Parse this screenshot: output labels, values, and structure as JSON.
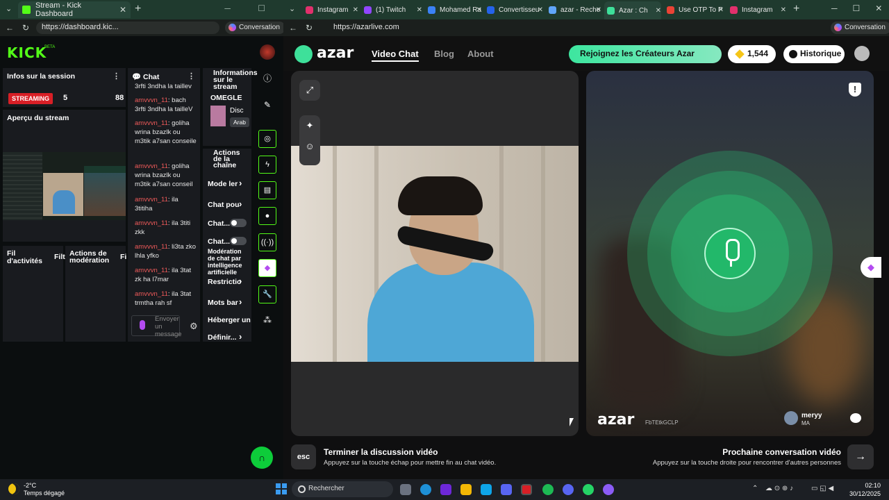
{
  "left_browser": {
    "tab_title": "Stream - Kick Dashboard",
    "url": "https://dashboard.kic...",
    "conversation_btn": "Conversation"
  },
  "kick": {
    "logo": "KICK",
    "beta": "BETA",
    "session_panel": {
      "title": "Infos sur la session",
      "streaming_badge": "STREAMING",
      "value1": "5",
      "value2": "88"
    },
    "preview_title": "Aperçu du stream",
    "activity_title": "Fil d'activités",
    "activity_filter": "Filt",
    "mod_actions_title": "Actions de modération",
    "mod_filter": "Fi",
    "chat": {
      "title": "Chat",
      "top_cut": "3rfti 3ndha la taillev",
      "messages": [
        {
          "user": "amvvvn_11",
          "text": ": bach 3rfti 3ndha la tailleV"
        },
        {
          "user": "amvvvn_11",
          "text": ": goliha wrina bzazlk ou m3tik a7san conseile"
        },
        {
          "user": "amvvvn_11",
          "text": ": goliha wrina bzazlk ou m3tik a7san conseil"
        },
        {
          "user": "amvvvn_11",
          "text": ": ila 3titiha"
        },
        {
          "user": "amvvvn_11",
          "text": ": ila 3titi zkk"
        },
        {
          "user": "amvvvn_11",
          "text": ": li3ta zko lhla yfko"
        },
        {
          "user": "amvvvn_11",
          "text": ": ila 3tat zk ha l7mar"
        },
        {
          "user": "amvvvn_11",
          "text": ": ila 3tat trmtha rah sf"
        }
      ],
      "input_placeholder": "Envoyer un message"
    },
    "info_panel": {
      "title": "Informations sur le stream",
      "category": "OMEGLE",
      "disc": "Disc",
      "tag": "Arab"
    },
    "channel_actions": {
      "title": "Actions de la chaîne",
      "items": [
        "Mode ler",
        "Chat pou",
        "Chat...",
        "Chat...",
        "Modération de chat par intelligence artificielle",
        "Restrictio",
        "Mots bar",
        "Héberger une",
        "Définir..."
      ]
    }
  },
  "right_browser": {
    "tabs": [
      "Instagram",
      "(1) Twitch",
      "Mohamed Ra",
      "Convertisseu",
      "azar - Reche",
      "Azar : Ch",
      "Use OTP To P",
      "Instagram"
    ],
    "url": "https://azarlive.com",
    "conversation_btn": "Conversation"
  },
  "azar": {
    "logo": "azar",
    "nav": [
      "Video Chat",
      "Blog",
      "About"
    ],
    "creators_btn": "Rejoignez les Créateurs Azar",
    "gems": "1,544",
    "history_btn": "Historique",
    "watermark": "azar",
    "watermark_code": "FbTEtkGCLP",
    "peer_name": "meryy",
    "peer_country": "MA",
    "end": {
      "key": "esc",
      "title": "Terminer la discussion vidéo",
      "sub": "Appuyez sur la touche échap pour mettre fin au chat vidéo."
    },
    "next": {
      "title": "Prochaine conversation vidéo",
      "sub": "Appuyez sur la touche droite pour rencontrer d'autres personnes"
    }
  },
  "taskbar": {
    "temp": "-2°C",
    "weather": "Temps dégagé",
    "search": "Rechercher",
    "time": "02:10",
    "date": "30/12/2025"
  }
}
